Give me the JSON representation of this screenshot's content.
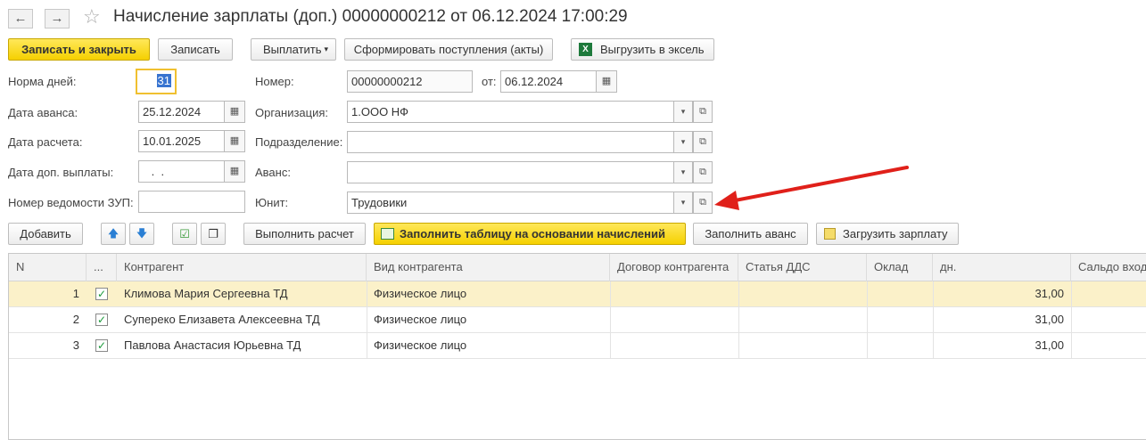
{
  "header": {
    "back_icon": "←",
    "forward_icon": "→",
    "star_icon": "☆",
    "title": "Начисление зарплаты (доп.) 00000000212 от 06.12.2024 17:00:29"
  },
  "toolbar": {
    "save_close": "Записать и закрыть",
    "save": "Записать",
    "pay": "Выплатить",
    "pay_arrow": "▾",
    "form_receipts": "Сформировать поступления (акты)",
    "excel_icon": "X",
    "export_excel": "Выгрузить в эксель"
  },
  "form": {
    "norma_label": "Норма дней:",
    "norma_value": "31",
    "advance_date_label": "Дата аванса:",
    "advance_date_value": "25.12.2024",
    "calc_date_label": "Дата расчета:",
    "calc_date_value": "10.01.2025",
    "extra_date_label": "Дата доп. выплаты:",
    "extra_date_value": " .  .",
    "zup_label": "Номер ведомости ЗУП:",
    "zup_value": "",
    "number_label": "Номер:",
    "number_value": "00000000212",
    "from_label": "от:",
    "from_value": "06.12.2024",
    "org_label": "Организация:",
    "org_value": "1.ООО НФ",
    "dept_label": "Подразделение:",
    "dept_value": "",
    "advance_label": "Аванс:",
    "advance_value": "",
    "unit_label": "Юнит:",
    "unit_value": "Трудовики",
    "calendar_icon": "▦",
    "dropdown_icon": "▾",
    "open_icon": "⧉"
  },
  "table_toolbar": {
    "add": "Добавить",
    "up_icon": "🡅",
    "down_icon": "🡇",
    "check_all_icon": "☑",
    "copy_icon": "❐",
    "calculate": "Выполнить расчет",
    "fill_table": "Заполнить таблицу на основании начислений",
    "fill_advance": "Заполнить аванс",
    "load_salary": "Загрузить зарплату"
  },
  "table": {
    "columns": [
      "N",
      "...",
      "Контрагент",
      "Вид контрагента",
      "Договор контрагента",
      "Статья ДДС",
      "Оклад",
      "дн.",
      "Сальдо вход"
    ],
    "rows": [
      {
        "n": "1",
        "checked": "✓",
        "contractor": "Климова Мария Сергеевна ТД",
        "kind": "Физическое лицо",
        "contract": "",
        "dds": "",
        "salary": "",
        "days": "31,00"
      },
      {
        "n": "2",
        "checked": "✓",
        "contractor": "Супереко Елизавета Алексеевна ТД",
        "kind": "Физическое лицо",
        "contract": "",
        "dds": "",
        "salary": "",
        "days": "31,00"
      },
      {
        "n": "3",
        "checked": "✓",
        "contractor": "Павлова Анастасия Юрьевна ТД",
        "kind": "Физическое лицо",
        "contract": "",
        "dds": "",
        "salary": "",
        "days": "31,00"
      }
    ]
  },
  "annotation": {
    "arrow_color": "#e0201a"
  }
}
